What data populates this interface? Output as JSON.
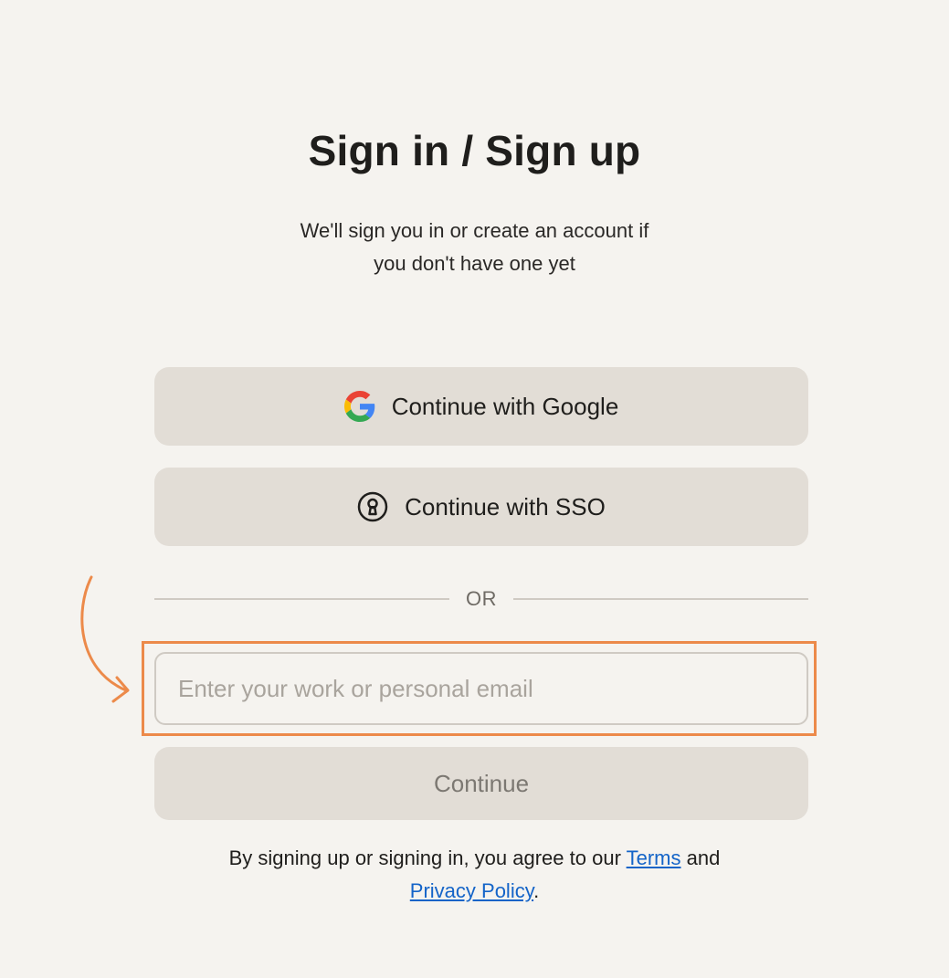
{
  "heading": {
    "title": "Sign in / Sign up",
    "subtitle_line1": "We'll sign you in or create an account if",
    "subtitle_line2": "you don't have one yet"
  },
  "buttons": {
    "google_label": "Continue with Google",
    "sso_label": "Continue with SSO",
    "continue_label": "Continue"
  },
  "divider": {
    "label": "OR"
  },
  "email": {
    "placeholder": "Enter your work or personal email",
    "value": ""
  },
  "legal": {
    "prefix": "By signing up or signing in, you agree to our",
    "terms_link": "Terms",
    "conjunction": "and",
    "privacy_link": "Privacy Policy",
    "suffix": "."
  },
  "icons": {
    "google": "google-logo-icon",
    "sso": "keyhole-icon",
    "annotation": "curved-arrow-icon"
  },
  "colors": {
    "background": "#f5f3ef",
    "button_bg": "#e2ddd6",
    "highlight": "#ec8a4a",
    "link": "#1464c8"
  }
}
